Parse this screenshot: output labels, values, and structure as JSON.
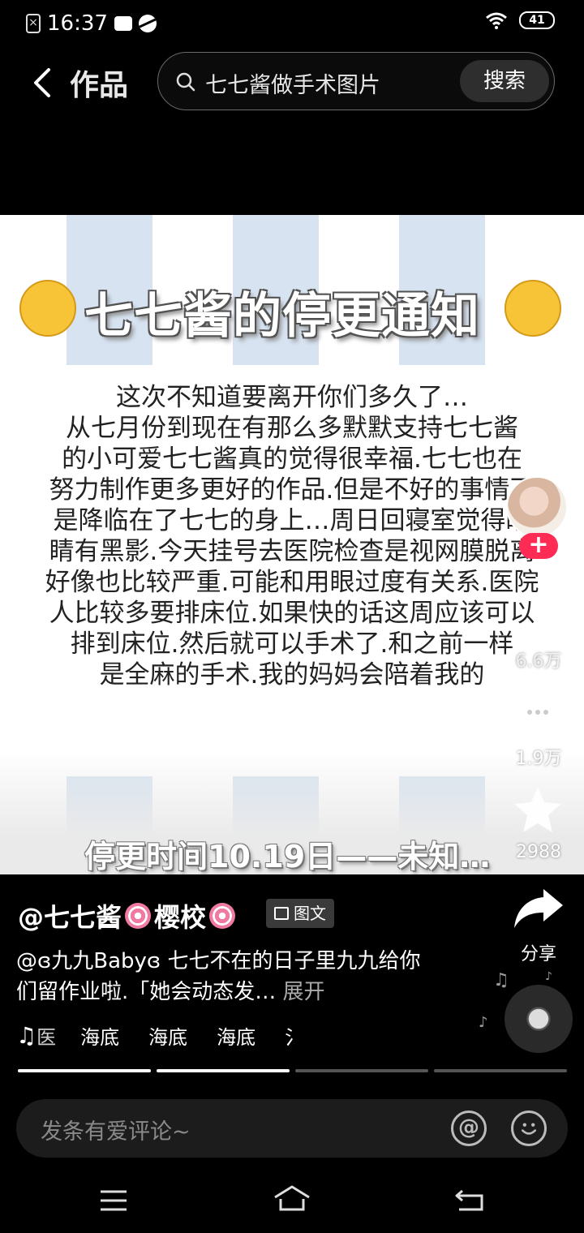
{
  "status_bar": {
    "time": "16:37",
    "battery": "41"
  },
  "top_bar": {
    "title": "作品",
    "search_text": "七七酱做手术图片",
    "search_button": "搜索"
  },
  "post": {
    "title": "七七酱的停更通知",
    "lines": [
      "这次不知道要离开你们多久了…",
      "从七月份到现在有那么多默默支持七七酱",
      "的小可爱七七酱真的觉得很幸福.七七也在",
      "努力制作更多更好的作品.但是不好的事情不",
      "是降临在了七七的身上…周日回寝室觉得眼",
      "睛有黑影.今天挂号去医院检查是视网膜脱离",
      "好像也比较严重.可能和用眼过度有关系.医院",
      "人比较多要排床位.如果快的话这周应该可以",
      "排到床位.然后就可以手术了.和之前一样",
      "是全麻的手术.我的妈妈会陪着我的"
    ],
    "bottom_text": "停更时间10.19日——未知…"
  },
  "actions": {
    "like_count": "6.6万",
    "comment_count": "1.9万",
    "favorite_count": "2988",
    "share_label": "分享",
    "follow_symbol": "+"
  },
  "info": {
    "author_name": "@七七酱",
    "author_suffix": "樱校",
    "badge": "图文",
    "description": "@ɞ九九Babyɞ 七七不在的日子里九九给你们留作业啦.「她会动态发…",
    "expand": "展开",
    "music_items": [
      "海底",
      "海底",
      "海底"
    ],
    "music_lead": "医",
    "music_tail": "氵"
  },
  "progress": {
    "segments_total": 4,
    "segments_done": 2
  },
  "comment_bar": {
    "placeholder": "发条有爱评论~",
    "at_symbol": "@"
  },
  "colors": {
    "accent": "#fe2c55",
    "stripe": "#d7e3f1",
    "background": "#000000"
  }
}
